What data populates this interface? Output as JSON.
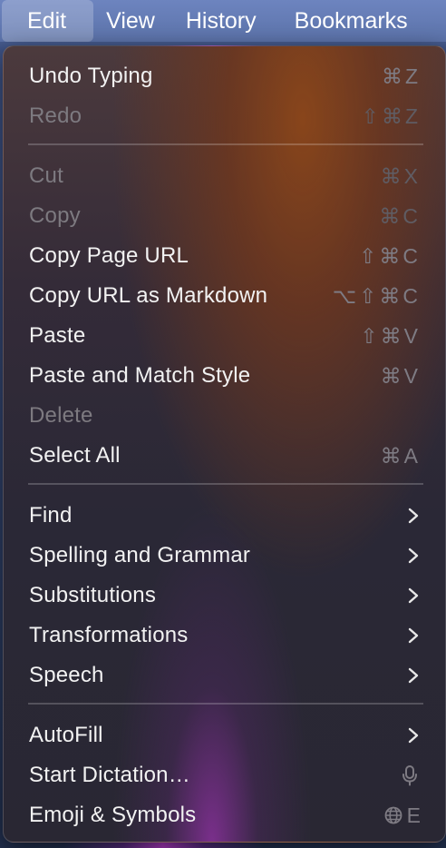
{
  "menubar": {
    "items": [
      "Edit",
      "View",
      "History",
      "Bookmarks"
    ]
  },
  "menu": {
    "items": [
      {
        "label": "Undo Typing",
        "shortcut": "⌘Z",
        "enabled": true
      },
      {
        "label": "Redo",
        "shortcut": "⇧⌘Z",
        "enabled": false
      },
      {
        "label": "Cut",
        "shortcut": "⌘X",
        "enabled": false
      },
      {
        "label": "Copy",
        "shortcut": "⌘C",
        "enabled": false
      },
      {
        "label": "Copy Page URL",
        "shortcut": "⇧⌘C",
        "enabled": true
      },
      {
        "label": "Copy URL as Markdown",
        "shortcut": "⌥⇧⌘C",
        "enabled": true
      },
      {
        "label": "Paste",
        "shortcut": "⇧⌘V",
        "enabled": true
      },
      {
        "label": "Paste and Match Style",
        "shortcut": "⌘V",
        "enabled": true
      },
      {
        "label": "Delete",
        "shortcut": "",
        "enabled": false
      },
      {
        "label": "Select All",
        "shortcut": "⌘A",
        "enabled": true
      },
      {
        "label": "Find",
        "submenu": true
      },
      {
        "label": "Spelling and Grammar",
        "submenu": true
      },
      {
        "label": "Substitutions",
        "submenu": true
      },
      {
        "label": "Transformations",
        "submenu": true
      },
      {
        "label": "Speech",
        "submenu": true
      },
      {
        "label": "AutoFill",
        "submenu": true
      },
      {
        "label": "Start Dictation…",
        "icon": "microphone-icon"
      },
      {
        "label": "Emoji & Symbols",
        "icon": "globe-icon",
        "shortcut": "E"
      }
    ]
  },
  "colors": {
    "menubar": "#5c73aa",
    "menu_text": "#f2f2f2",
    "disabled_text": "#7d7a80",
    "shortcut_text": "#7e7b83"
  }
}
